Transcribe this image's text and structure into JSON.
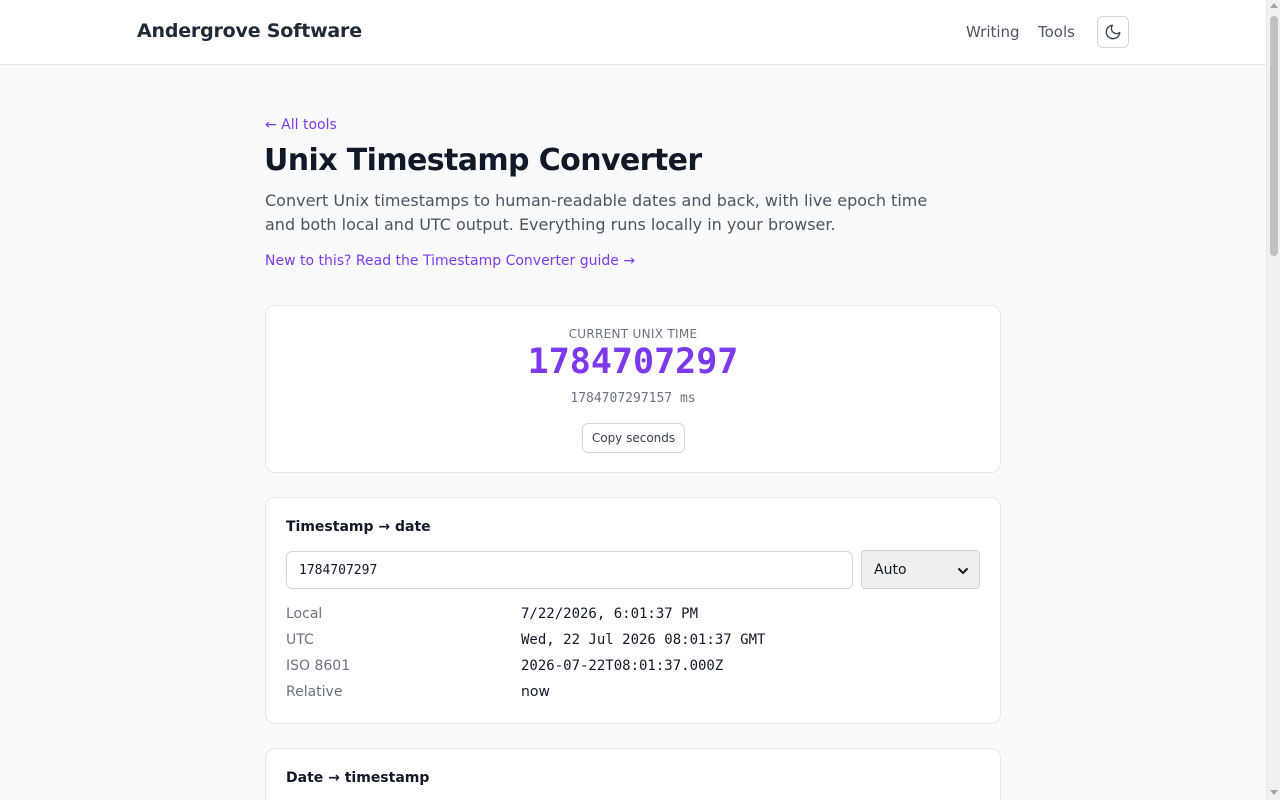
{
  "header": {
    "brand": "Andergrove Software",
    "nav": [
      {
        "label": "Writing"
      },
      {
        "label": "Tools"
      }
    ],
    "theme_icon": "moon-icon"
  },
  "page": {
    "back_link": "← All tools",
    "title": "Unix Timestamp Converter",
    "description": "Convert Unix timestamps to human-readable dates and back, with live epoch time and both local and UTC output. Everything runs locally in your browser.",
    "guide_link": "New to this? Read the Timestamp Converter guide →"
  },
  "current": {
    "label": "CURRENT UNIX TIME",
    "seconds": "1784707297",
    "ms": "1784707297157 ms",
    "copy_label": "Copy seconds"
  },
  "timestamp_to_date": {
    "title": "Timestamp → date",
    "input_value": "1784707297",
    "unit_selected": "Auto",
    "outputs": [
      {
        "label": "Local",
        "value": "7/22/2026, 6:01:37 PM"
      },
      {
        "label": "UTC",
        "value": "Wed, 22 Jul 2026 08:01:37 GMT"
      },
      {
        "label": "ISO 8601",
        "value": "2026-07-22T08:01:37.000Z"
      },
      {
        "label": "Relative",
        "value": "now"
      }
    ]
  },
  "date_to_timestamp": {
    "title": "Date → timestamp"
  },
  "colors": {
    "accent": "#7c3aed",
    "text": "#111827",
    "muted": "#6b7280",
    "border": "#e5e7eb"
  }
}
